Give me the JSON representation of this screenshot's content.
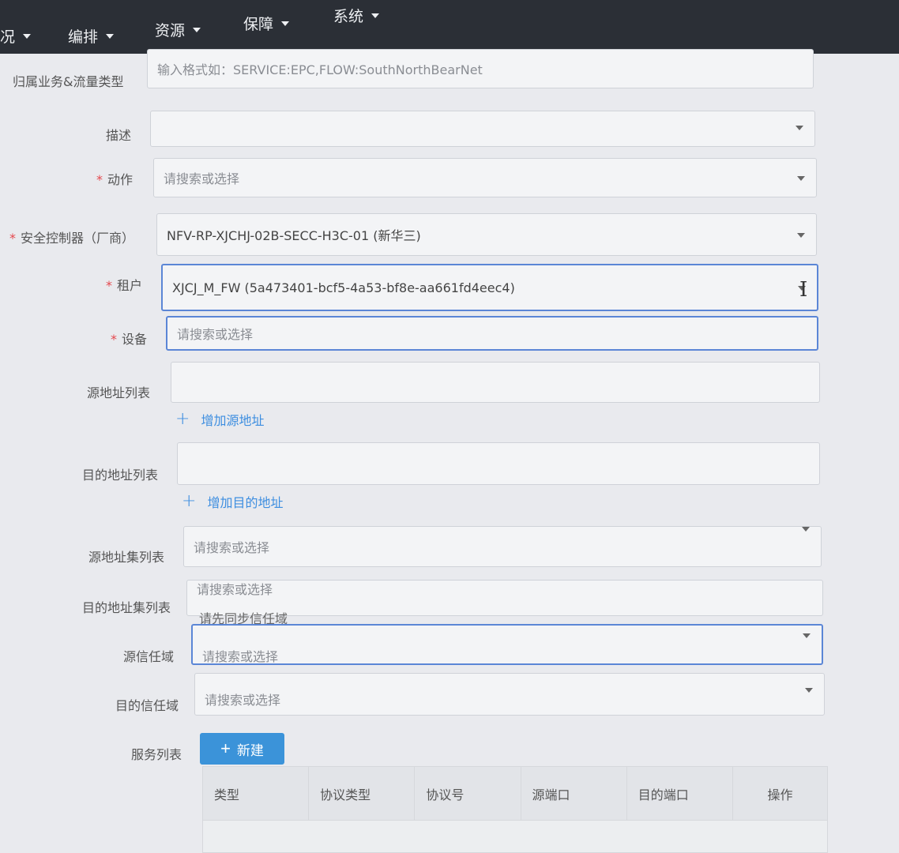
{
  "nav": {
    "items": [
      "况",
      "编排",
      "资源",
      "保障",
      "系统"
    ]
  },
  "form": {
    "business_flow": {
      "label": "归属业务&流量类型",
      "placeholder": "输入格式如：SERVICE:EPC,FLOW:SouthNorthBearNet"
    },
    "description": {
      "label": "描述",
      "value": ""
    },
    "action": {
      "label": "动作",
      "required": "*",
      "placeholder": "请搜索或选择"
    },
    "controller": {
      "label": "安全控制器（厂商）",
      "required": "*",
      "value": "NFV-RP-XJCHJ-02B-SECC-H3C-01 (新华三)"
    },
    "tenant": {
      "label": "租户",
      "required": "*",
      "value": "XJCJ_M_FW (5a473401-bcf5-4a53-bf8e-aa661fd4eec4)"
    },
    "device": {
      "label": "设备",
      "required": "*",
      "placeholder": "请搜索或选择"
    },
    "src_addr_list": {
      "label": "源地址列表",
      "add_label": "增加源地址"
    },
    "dst_addr_list": {
      "label": "目的地址列表",
      "add_label": "增加目的地址"
    },
    "src_addr_set": {
      "label": "源地址集列表",
      "placeholder": "请搜索或选择"
    },
    "dst_addr_set": {
      "label": "目的地址集列表",
      "placeholder": "请搜索或选择",
      "hint": "请先同步信任域"
    },
    "src_zone": {
      "label": "源信任域",
      "placeholder": "请搜索或选择"
    },
    "dst_zone": {
      "label": "目的信任域",
      "placeholder": "请搜索或选择"
    },
    "services": {
      "label": "服务列表",
      "new_button": "新建",
      "columns": [
        "类型",
        "协议类型",
        "协议号",
        "源端口",
        "目的端口",
        "操作"
      ]
    }
  },
  "icons": {
    "plus": "+",
    "dropdown": "caret-down-icon"
  },
  "colors": {
    "nav_bg": "#2b2f36",
    "accent": "#3b93d9",
    "required": "#e5484d",
    "focus": "#5b86d6"
  }
}
